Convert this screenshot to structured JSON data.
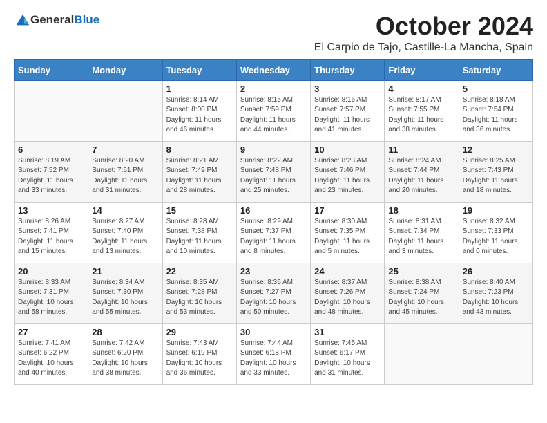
{
  "header": {
    "logo_general": "General",
    "logo_blue": "Blue",
    "month": "October 2024",
    "location": "El Carpio de Tajo, Castille-La Mancha, Spain"
  },
  "days_of_week": [
    "Sunday",
    "Monday",
    "Tuesday",
    "Wednesday",
    "Thursday",
    "Friday",
    "Saturday"
  ],
  "weeks": [
    [
      {
        "day": "",
        "info": ""
      },
      {
        "day": "",
        "info": ""
      },
      {
        "day": "1",
        "info": "Sunrise: 8:14 AM\nSunset: 8:00 PM\nDaylight: 11 hours and 46 minutes."
      },
      {
        "day": "2",
        "info": "Sunrise: 8:15 AM\nSunset: 7:59 PM\nDaylight: 11 hours and 44 minutes."
      },
      {
        "day": "3",
        "info": "Sunrise: 8:16 AM\nSunset: 7:57 PM\nDaylight: 11 hours and 41 minutes."
      },
      {
        "day": "4",
        "info": "Sunrise: 8:17 AM\nSunset: 7:55 PM\nDaylight: 11 hours and 38 minutes."
      },
      {
        "day": "5",
        "info": "Sunrise: 8:18 AM\nSunset: 7:54 PM\nDaylight: 11 hours and 36 minutes."
      }
    ],
    [
      {
        "day": "6",
        "info": "Sunrise: 8:19 AM\nSunset: 7:52 PM\nDaylight: 11 hours and 33 minutes."
      },
      {
        "day": "7",
        "info": "Sunrise: 8:20 AM\nSunset: 7:51 PM\nDaylight: 11 hours and 31 minutes."
      },
      {
        "day": "8",
        "info": "Sunrise: 8:21 AM\nSunset: 7:49 PM\nDaylight: 11 hours and 28 minutes."
      },
      {
        "day": "9",
        "info": "Sunrise: 8:22 AM\nSunset: 7:48 PM\nDaylight: 11 hours and 25 minutes."
      },
      {
        "day": "10",
        "info": "Sunrise: 8:23 AM\nSunset: 7:46 PM\nDaylight: 11 hours and 23 minutes."
      },
      {
        "day": "11",
        "info": "Sunrise: 8:24 AM\nSunset: 7:44 PM\nDaylight: 11 hours and 20 minutes."
      },
      {
        "day": "12",
        "info": "Sunrise: 8:25 AM\nSunset: 7:43 PM\nDaylight: 11 hours and 18 minutes."
      }
    ],
    [
      {
        "day": "13",
        "info": "Sunrise: 8:26 AM\nSunset: 7:41 PM\nDaylight: 11 hours and 15 minutes."
      },
      {
        "day": "14",
        "info": "Sunrise: 8:27 AM\nSunset: 7:40 PM\nDaylight: 11 hours and 13 minutes."
      },
      {
        "day": "15",
        "info": "Sunrise: 8:28 AM\nSunset: 7:38 PM\nDaylight: 11 hours and 10 minutes."
      },
      {
        "day": "16",
        "info": "Sunrise: 8:29 AM\nSunset: 7:37 PM\nDaylight: 11 hours and 8 minutes."
      },
      {
        "day": "17",
        "info": "Sunrise: 8:30 AM\nSunset: 7:35 PM\nDaylight: 11 hours and 5 minutes."
      },
      {
        "day": "18",
        "info": "Sunrise: 8:31 AM\nSunset: 7:34 PM\nDaylight: 11 hours and 3 minutes."
      },
      {
        "day": "19",
        "info": "Sunrise: 8:32 AM\nSunset: 7:33 PM\nDaylight: 11 hours and 0 minutes."
      }
    ],
    [
      {
        "day": "20",
        "info": "Sunrise: 8:33 AM\nSunset: 7:31 PM\nDaylight: 10 hours and 58 minutes."
      },
      {
        "day": "21",
        "info": "Sunrise: 8:34 AM\nSunset: 7:30 PM\nDaylight: 10 hours and 55 minutes."
      },
      {
        "day": "22",
        "info": "Sunrise: 8:35 AM\nSunset: 7:28 PM\nDaylight: 10 hours and 53 minutes."
      },
      {
        "day": "23",
        "info": "Sunrise: 8:36 AM\nSunset: 7:27 PM\nDaylight: 10 hours and 50 minutes."
      },
      {
        "day": "24",
        "info": "Sunrise: 8:37 AM\nSunset: 7:26 PM\nDaylight: 10 hours and 48 minutes."
      },
      {
        "day": "25",
        "info": "Sunrise: 8:38 AM\nSunset: 7:24 PM\nDaylight: 10 hours and 45 minutes."
      },
      {
        "day": "26",
        "info": "Sunrise: 8:40 AM\nSunset: 7:23 PM\nDaylight: 10 hours and 43 minutes."
      }
    ],
    [
      {
        "day": "27",
        "info": "Sunrise: 7:41 AM\nSunset: 6:22 PM\nDaylight: 10 hours and 40 minutes."
      },
      {
        "day": "28",
        "info": "Sunrise: 7:42 AM\nSunset: 6:20 PM\nDaylight: 10 hours and 38 minutes."
      },
      {
        "day": "29",
        "info": "Sunrise: 7:43 AM\nSunset: 6:19 PM\nDaylight: 10 hours and 36 minutes."
      },
      {
        "day": "30",
        "info": "Sunrise: 7:44 AM\nSunset: 6:18 PM\nDaylight: 10 hours and 33 minutes."
      },
      {
        "day": "31",
        "info": "Sunrise: 7:45 AM\nSunset: 6:17 PM\nDaylight: 10 hours and 31 minutes."
      },
      {
        "day": "",
        "info": ""
      },
      {
        "day": "",
        "info": ""
      }
    ]
  ]
}
